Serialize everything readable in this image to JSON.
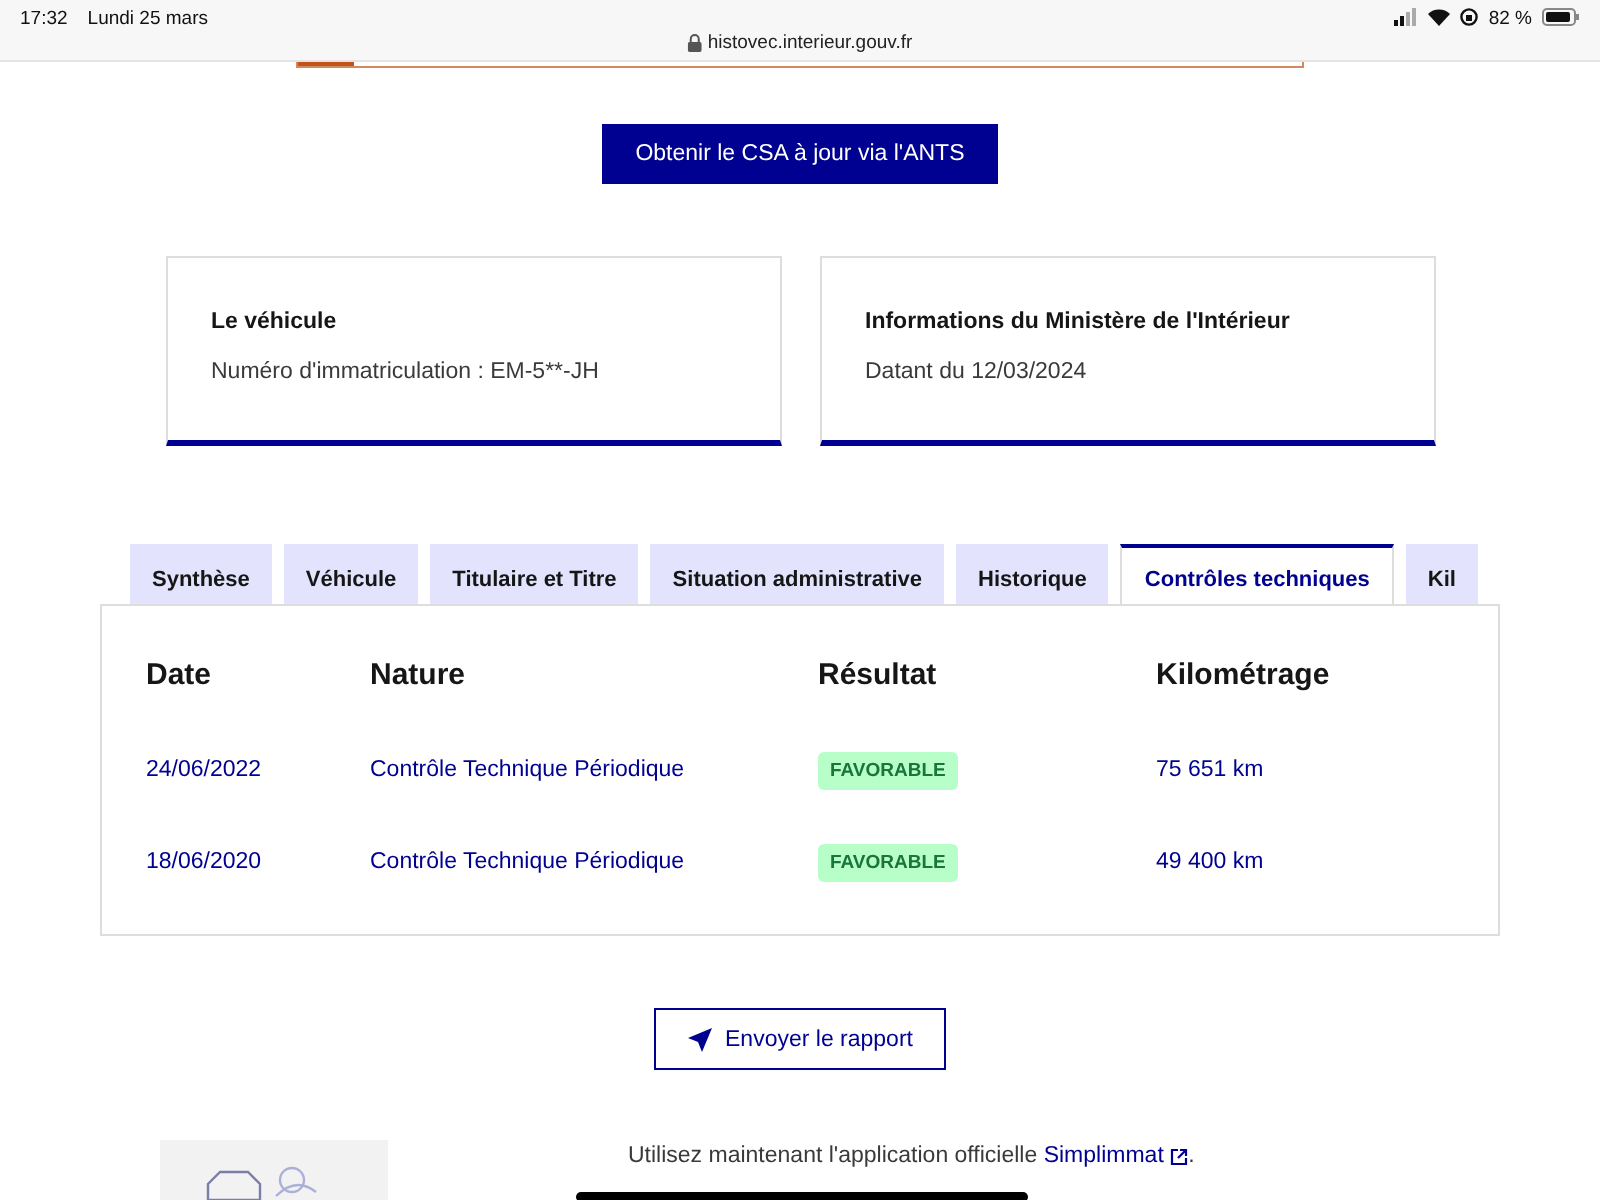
{
  "status_bar": {
    "time": "17:32",
    "date": "Lundi 25 mars",
    "url": "histovec.interieur.gouv.fr",
    "battery": "82 %"
  },
  "csa_button": "Obtenir le CSA à jour via l'ANTS",
  "cards": [
    {
      "title": "Le véhicule",
      "text": "Numéro d'immatriculation : EM-5**-JH"
    },
    {
      "title": "Informations du Ministère de l'Intérieur",
      "text": "Datant du 12/03/2024"
    }
  ],
  "tabs": [
    {
      "label": "Synthèse",
      "selected": false
    },
    {
      "label": "Véhicule",
      "selected": false
    },
    {
      "label": "Titulaire et Titre",
      "selected": false
    },
    {
      "label": "Situation administrative",
      "selected": false
    },
    {
      "label": "Historique",
      "selected": false
    },
    {
      "label": "Contrôles techniques",
      "selected": true
    },
    {
      "label": "Kil",
      "selected": false
    }
  ],
  "table": {
    "columns": [
      "Date",
      "Nature",
      "Résultat",
      "Kilométrage"
    ],
    "rows": [
      {
        "date": "24/06/2022",
        "nature": "Contrôle Technique Périodique",
        "result": "FAVORABLE",
        "mileage": "75 651 km"
      },
      {
        "date": "18/06/2020",
        "nature": "Contrôle Technique Périodique",
        "result": "FAVORABLE",
        "mileage": "49 400 km"
      }
    ]
  },
  "send_button": "Envoyer le rapport",
  "footer": {
    "text": "Utilisez maintenant l'application officielle",
    "link": "Simplimmat",
    "end": "."
  }
}
